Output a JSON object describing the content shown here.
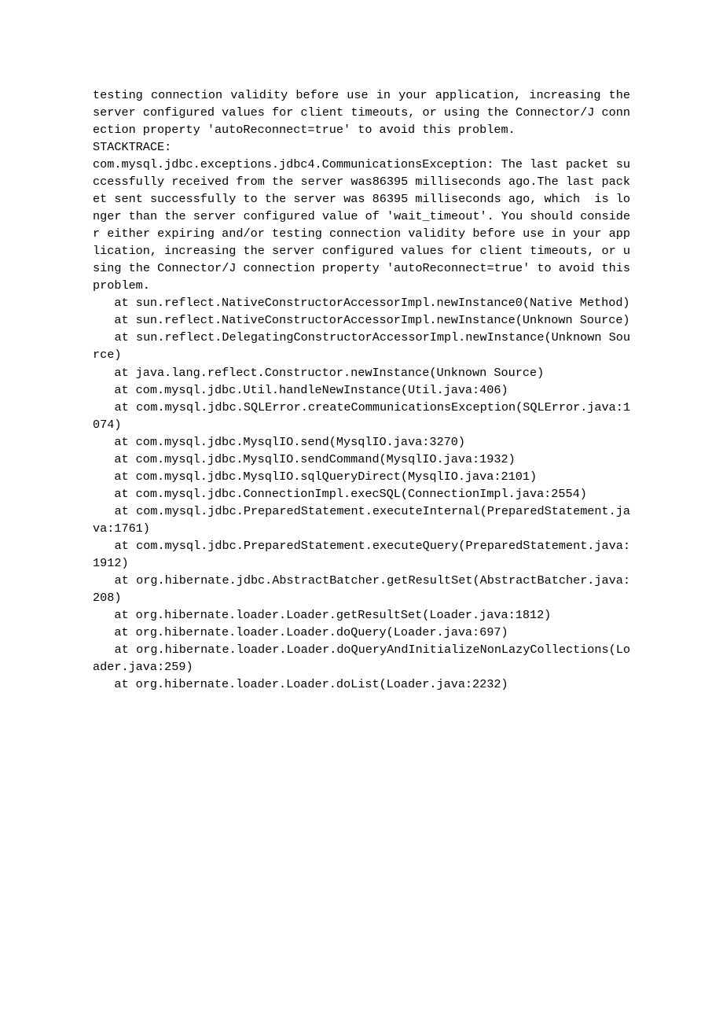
{
  "lines": [
    "testing connection validity before use in your application, increasing the server configured values for client timeouts, or using the Connector/J connection property 'autoReconnect=true' to avoid this problem.",
    "STACKTRACE:",
    "com.mysql.jdbc.exceptions.jdbc4.CommunicationsException: The last packet successfully received from the server was86395 milliseconds ago.The last packet sent successfully to the server was 86395 milliseconds ago, which  is longer than the server configured value of 'wait_timeout'. You should consider either expiring and/or testing connection validity before use in your application, increasing the server configured values for client timeouts, or using the Connector/J connection property 'autoReconnect=true' to avoid this problem.",
    "   at sun.reflect.NativeConstructorAccessorImpl.newInstance0(Native Method)",
    "   at sun.reflect.NativeConstructorAccessorImpl.newInstance(Unknown Source)",
    "   at sun.reflect.DelegatingConstructorAccessorImpl.newInstance(Unknown Source)",
    "   at java.lang.reflect.Constructor.newInstance(Unknown Source)",
    "   at com.mysql.jdbc.Util.handleNewInstance(Util.java:406)",
    "   at com.mysql.jdbc.SQLError.createCommunicationsException(SQLError.java:1074)",
    "   at com.mysql.jdbc.MysqlIO.send(MysqlIO.java:3270)",
    "   at com.mysql.jdbc.MysqlIO.sendCommand(MysqlIO.java:1932)",
    "   at com.mysql.jdbc.MysqlIO.sqlQueryDirect(MysqlIO.java:2101)",
    "   at com.mysql.jdbc.ConnectionImpl.execSQL(ConnectionImpl.java:2554)",
    "   at com.mysql.jdbc.PreparedStatement.executeInternal(PreparedStatement.java:1761)",
    "   at com.mysql.jdbc.PreparedStatement.executeQuery(PreparedStatement.java:1912)",
    "   at org.hibernate.jdbc.AbstractBatcher.getResultSet(AbstractBatcher.java:208)",
    "   at org.hibernate.loader.Loader.getResultSet(Loader.java:1812)",
    "   at org.hibernate.loader.Loader.doQuery(Loader.java:697)",
    "   at org.hibernate.loader.Loader.doQueryAndInitializeNonLazyCollections(Loader.java:259)",
    "   at org.hibernate.loader.Loader.doList(Loader.java:2232)"
  ]
}
